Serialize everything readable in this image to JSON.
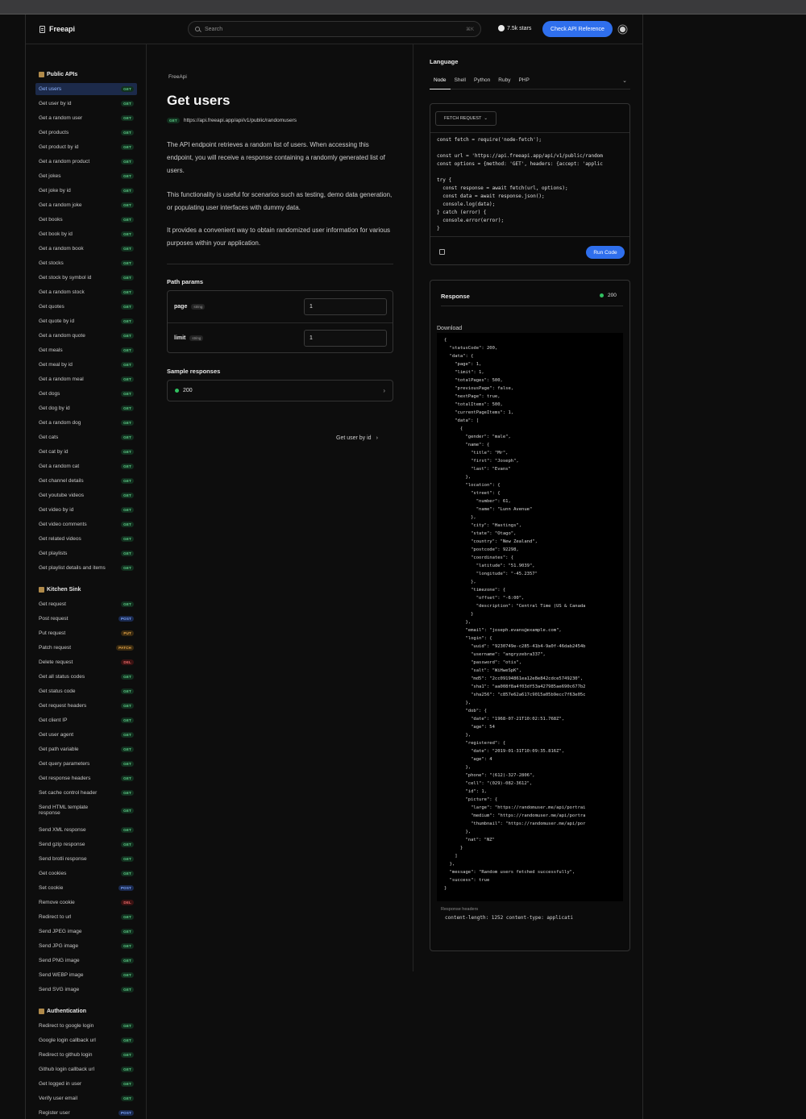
{
  "header": {
    "brand": "Freeapi",
    "search_placeholder": "Search",
    "search_shortcut": "⌘K",
    "stars": "7.5k stars",
    "api_ref_button": "Check API Reference"
  },
  "sidebar": {
    "groups": [
      {
        "title": "Public APIs",
        "icon": "bookmark-icon",
        "items": [
          {
            "label": "Get users",
            "method": "GET",
            "active": true
          },
          {
            "label": "Get user by id",
            "method": "GET"
          },
          {
            "label": "Get a random user",
            "method": "GET"
          },
          {
            "label": "Get products",
            "method": "GET"
          },
          {
            "label": "Get product by id",
            "method": "GET"
          },
          {
            "label": "Get a random product",
            "method": "GET"
          },
          {
            "label": "Get jokes",
            "method": "GET"
          },
          {
            "label": "Get joke by id",
            "method": "GET"
          },
          {
            "label": "Get a random joke",
            "method": "GET"
          },
          {
            "label": "Get books",
            "method": "GET"
          },
          {
            "label": "Get book by id",
            "method": "GET"
          },
          {
            "label": "Get a random book",
            "method": "GET"
          },
          {
            "label": "Get stocks",
            "method": "GET"
          },
          {
            "label": "Get stock by symbol id",
            "method": "GET"
          },
          {
            "label": "Get a random stock",
            "method": "GET"
          },
          {
            "label": "Get quotes",
            "method": "GET"
          },
          {
            "label": "Get quote by id",
            "method": "GET"
          },
          {
            "label": "Get a random quote",
            "method": "GET"
          },
          {
            "label": "Get meals",
            "method": "GET"
          },
          {
            "label": "Get meal by id",
            "method": "GET"
          },
          {
            "label": "Get a random meal",
            "method": "GET"
          },
          {
            "label": "Get dogs",
            "method": "GET"
          },
          {
            "label": "Get dog by id",
            "method": "GET"
          },
          {
            "label": "Get a random dog",
            "method": "GET"
          },
          {
            "label": "Get cats",
            "method": "GET"
          },
          {
            "label": "Get cat by id",
            "method": "GET"
          },
          {
            "label": "Get a random cat",
            "method": "GET"
          },
          {
            "label": "Get channel details",
            "method": "GET"
          },
          {
            "label": "Get youtube videos",
            "method": "GET"
          },
          {
            "label": "Get video by id",
            "method": "GET"
          },
          {
            "label": "Get video comments",
            "method": "GET"
          },
          {
            "label": "Get related videos",
            "method": "GET"
          },
          {
            "label": "Get playlists",
            "method": "GET"
          },
          {
            "label": "Get playlist details and items",
            "method": "GET"
          }
        ]
      },
      {
        "title": "Kitchen Sink",
        "icon": "sink-icon",
        "items": [
          {
            "label": "Get request",
            "method": "GET"
          },
          {
            "label": "Post request",
            "method": "POST"
          },
          {
            "label": "Put request",
            "method": "PUT"
          },
          {
            "label": "Patch request",
            "method": "PATCH"
          },
          {
            "label": "Delete request",
            "method": "DEL"
          },
          {
            "label": "Get all status codes",
            "method": "GET"
          },
          {
            "label": "Get status code",
            "method": "GET"
          },
          {
            "label": "Get request headers",
            "method": "GET"
          },
          {
            "label": "Get client IP",
            "method": "GET"
          },
          {
            "label": "Get user agent",
            "method": "GET"
          },
          {
            "label": "Get path variable",
            "method": "GET"
          },
          {
            "label": "Get query parameters",
            "method": "GET"
          },
          {
            "label": "Get response headers",
            "method": "GET"
          },
          {
            "label": "Set cache control header",
            "method": "GET"
          },
          {
            "label": "Send HTML template response",
            "method": "GET"
          },
          {
            "label": "Send XML response",
            "method": "GET"
          },
          {
            "label": "Send gzip response",
            "method": "GET"
          },
          {
            "label": "Send brotli response",
            "method": "GET"
          },
          {
            "label": "Get cookies",
            "method": "GET"
          },
          {
            "label": "Set cookie",
            "method": "POST"
          },
          {
            "label": "Remove cookie",
            "method": "DEL"
          },
          {
            "label": "Redirect to url",
            "method": "GET"
          },
          {
            "label": "Send JPEG image",
            "method": "GET"
          },
          {
            "label": "Send JPG image",
            "method": "GET"
          },
          {
            "label": "Send PNG image",
            "method": "GET"
          },
          {
            "label": "Send WEBP image",
            "method": "GET"
          },
          {
            "label": "Send SVG image",
            "method": "GET"
          }
        ]
      },
      {
        "title": "Authentication",
        "icon": "lock-icon",
        "items": [
          {
            "label": "Redirect to google login",
            "method": "GET"
          },
          {
            "label": "Google login callback url",
            "method": "GET"
          },
          {
            "label": "Redirect to github login",
            "method": "GET"
          },
          {
            "label": "Github login callback url",
            "method": "GET"
          },
          {
            "label": "Get logged in user",
            "method": "GET"
          },
          {
            "label": "Verify user email",
            "method": "GET"
          },
          {
            "label": "Register user",
            "method": "POST"
          }
        ]
      }
    ]
  },
  "main": {
    "breadcrumb": "FreeApi",
    "title": "Get users",
    "method": "GET",
    "url": "https://api.freeapi.app/api/v1/public/randomusers",
    "paragraphs": [
      "The API endpoint retrieves a random list of users. When accessing this endpoint, you will receive a response containing a randomly generated list of users.",
      "This functionality is useful for scenarios such as testing, demo data generation, or populating user interfaces with dummy data.",
      "It provides a convenient way to obtain randomized user information for various purposes within your application."
    ],
    "path_params_title": "Path params",
    "params": [
      {
        "name": "page",
        "type": "string",
        "value": "1"
      },
      {
        "name": "limit",
        "type": "string",
        "value": "1"
      }
    ],
    "sample_title": "Sample responses",
    "sample_status": "200",
    "next_link": "Get user by id"
  },
  "right": {
    "language_title": "Language",
    "tabs": [
      "Node",
      "Shell",
      "Python",
      "Ruby",
      "PHP"
    ],
    "active_tab": "Node",
    "fetch_select": "FETCH REQUEST",
    "code": "const fetch = require('node-fetch');\n\nconst url = 'https://api.freeapi.app/api/v1/public/random\nconst options = {method: 'GET', headers: {accept: 'applic\n\ntry {\n  const response = await fetch(url, options);\n  const data = await response.json();\n  console.log(data);\n} catch (error) {\n  console.error(error);\n}",
    "run_button": "Run Code",
    "response_title": "Response",
    "response_status": "200",
    "download": "Download",
    "json": "{\n  \"statusCode\": 200,\n  \"data\": {\n    \"page\": 1,\n    \"limit\": 1,\n    \"totalPages\": 500,\n    \"previousPage\": false,\n    \"nextPage\": true,\n    \"totalItems\": 500,\n    \"currentPageItems\": 1,\n    \"data\": [\n      {\n        \"gender\": \"male\",\n        \"name\": {\n          \"title\": \"Mr\",\n          \"first\": \"Joseph\",\n          \"last\": \"Evans\"\n        },\n        \"location\": {\n          \"street\": {\n            \"number\": 61,\n            \"name\": \"Lunn Avenue\"\n          },\n          \"city\": \"Hastings\",\n          \"state\": \"Otago\",\n          \"country\": \"New Zealand\",\n          \"postcode\": 92298,\n          \"coordinates\": {\n            \"latitude\": \"51.9039\",\n            \"longitude\": \"-45.2357\"\n          },\n          \"timezone\": {\n            \"offset\": \"-6:00\",\n            \"description\": \"Central Time (US & Canada\n          }\n        },\n        \"email\": \"joseph.evans@example.com\",\n        \"login\": {\n          \"uuid\": \"9230749e-c285-41b4-9a0f-46dab2454b\n          \"username\": \"angryzebra337\",\n          \"password\": \"otis\",\n          \"salt\": \"WiHweSpK\",\n          \"md5\": \"2cc09194861ea12e8e842cdce5749230\",\n          \"sha1\": \"aa008f8a4f03df53a427985ae690c677b2\n          \"sha256\": \"c857e62a617c9015a05b9ecc7f63e05c\n        },\n        \"dob\": {\n          \"date\": \"1968-07-21T10:02:51.768Z\",\n          \"age\": 54\n        },\n        \"registered\": {\n          \"date\": \"2019-01-31T10:09:35.816Z\",\n          \"age\": 4\n        },\n        \"phone\": \"(612)-327-2806\",\n        \"cell\": \"(029)-082-3612\",\n        \"id\": 1,\n        \"picture\": {\n          \"large\": \"https://randomuser.me/api/portrai\n          \"medium\": \"https://randomuser.me/api/portra\n          \"thumbnail\": \"https://randomuser.me/api/por\n        },\n        \"nat\": \"NZ\"\n      }\n    ]\n  },\n  \"message\": \"Random users fetched successfully\",\n  \"success\": true\n}",
    "response_headers_title": "Response headers",
    "response_headers": "content-length: 1252  content-type: applicati"
  }
}
